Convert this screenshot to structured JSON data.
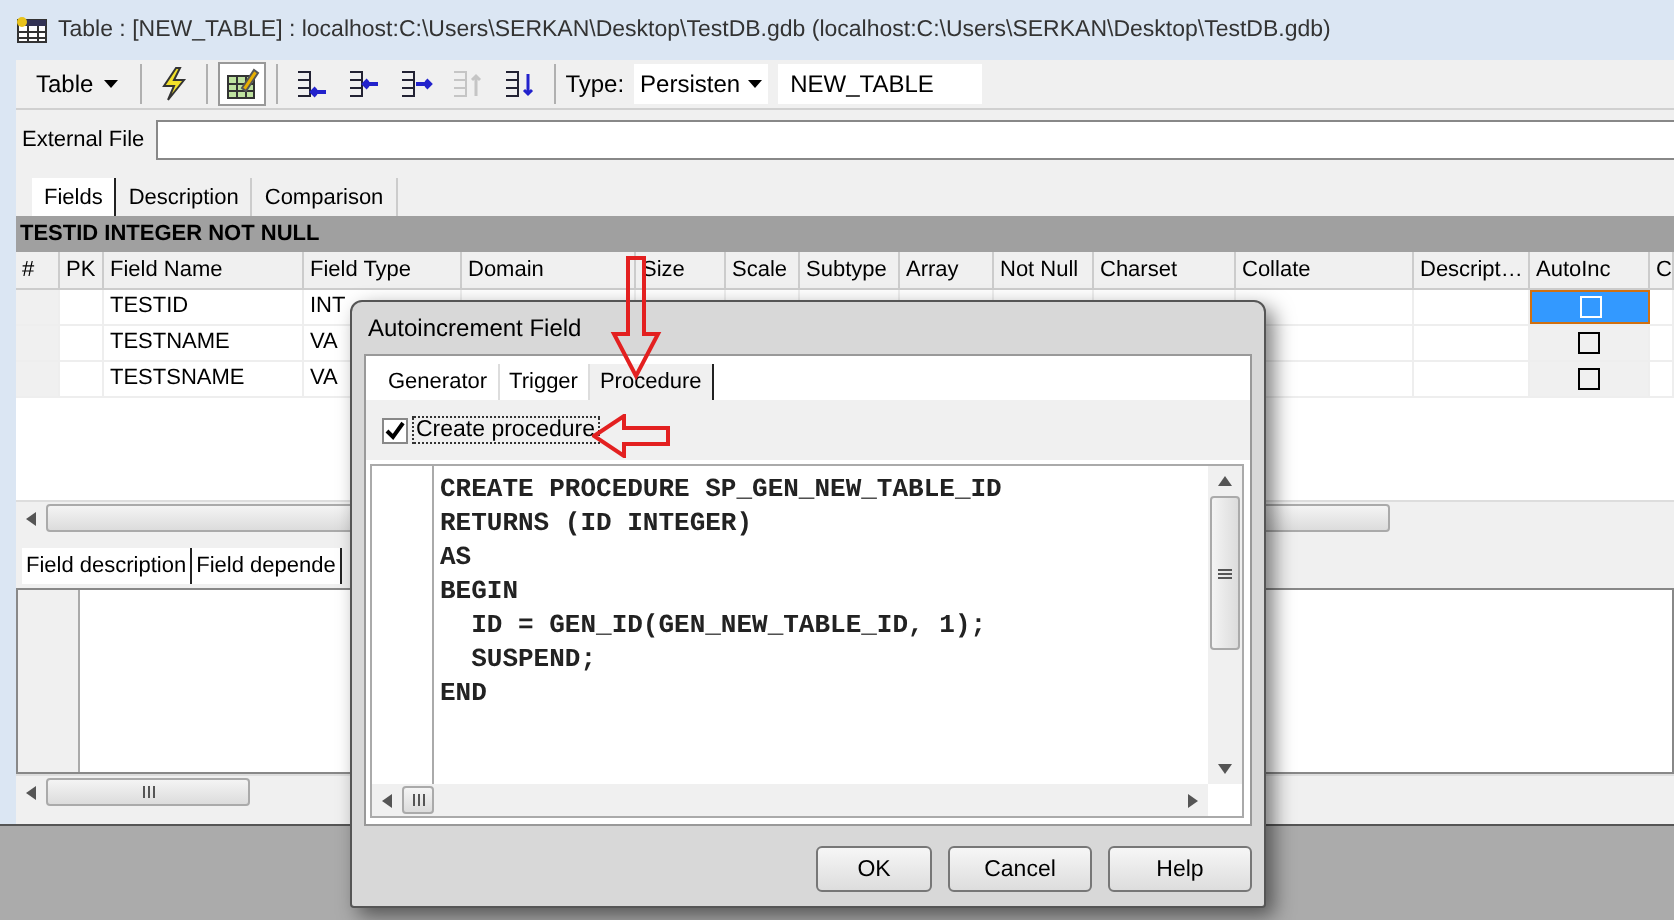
{
  "window": {
    "title": "Table : [NEW_TABLE] : localhost:C:\\Users\\SERKAN\\Desktop\\TestDB.gdb (localhost:C:\\Users\\SERKAN\\Desktop\\TestDB.gdb)"
  },
  "toolbar": {
    "menu": "Table",
    "tools": [
      {
        "kind": "lightning",
        "pressed": false,
        "disabled": false
      },
      {
        "kind": "grid-edit",
        "pressed": true,
        "disabled": false
      },
      {
        "kind": "insert",
        "pressed": false,
        "disabled": false
      },
      {
        "kind": "add",
        "pressed": false,
        "disabled": false
      },
      {
        "kind": "move",
        "pressed": false,
        "disabled": false
      },
      {
        "kind": "up",
        "pressed": false,
        "disabled": true
      },
      {
        "kind": "down",
        "pressed": false,
        "disabled": false
      }
    ],
    "type_label": "Type:",
    "type_value": "Persisten",
    "table_name": "NEW_TABLE"
  },
  "external_file": {
    "label": "External File"
  },
  "tabs": [
    {
      "label": "Fields",
      "selected": true
    },
    {
      "label": "Description",
      "selected": false
    },
    {
      "label": "Comparison",
      "selected": false
    }
  ],
  "header_bar": "TESTID INTEGER NOT NULL",
  "grid": {
    "columns": [
      "#",
      "PK",
      "Field Name",
      "Field Type",
      "Domain",
      "Size",
      "Scale",
      "Subtype",
      "Array",
      "Not Null",
      "Charset",
      "Collate",
      "Descript…",
      "AutoInc",
      "C"
    ],
    "rows": [
      {
        "field_name": "TESTID",
        "field_type": "INT",
        "autoinc": false,
        "selected": true
      },
      {
        "field_name": "TESTNAME",
        "field_type": "VA",
        "autoinc": false,
        "selected": false
      },
      {
        "field_name": "TESTSNAME",
        "field_type": "VA",
        "autoinc": false,
        "selected": false
      }
    ]
  },
  "bottom_tabs": [
    {
      "label": "Field description"
    },
    {
      "label": "Field depende"
    }
  ],
  "dialog": {
    "title": "Autoincrement Field",
    "tabs": [
      {
        "label": "Generator",
        "selected": false
      },
      {
        "label": "Trigger",
        "selected": false
      },
      {
        "label": "Procedure",
        "selected": true
      }
    ],
    "create_procedure": {
      "label": "Create procedure",
      "checked": true
    },
    "code_lines": [
      "CREATE PROCEDURE SP_GEN_NEW_TABLE_ID",
      "RETURNS (ID INTEGER)",
      "AS",
      "BEGIN",
      "  ID = GEN_ID(GEN_NEW_TABLE_ID, 1);",
      "  SUSPEND;",
      "END"
    ],
    "buttons": [
      "OK",
      "Cancel",
      "Help"
    ]
  }
}
